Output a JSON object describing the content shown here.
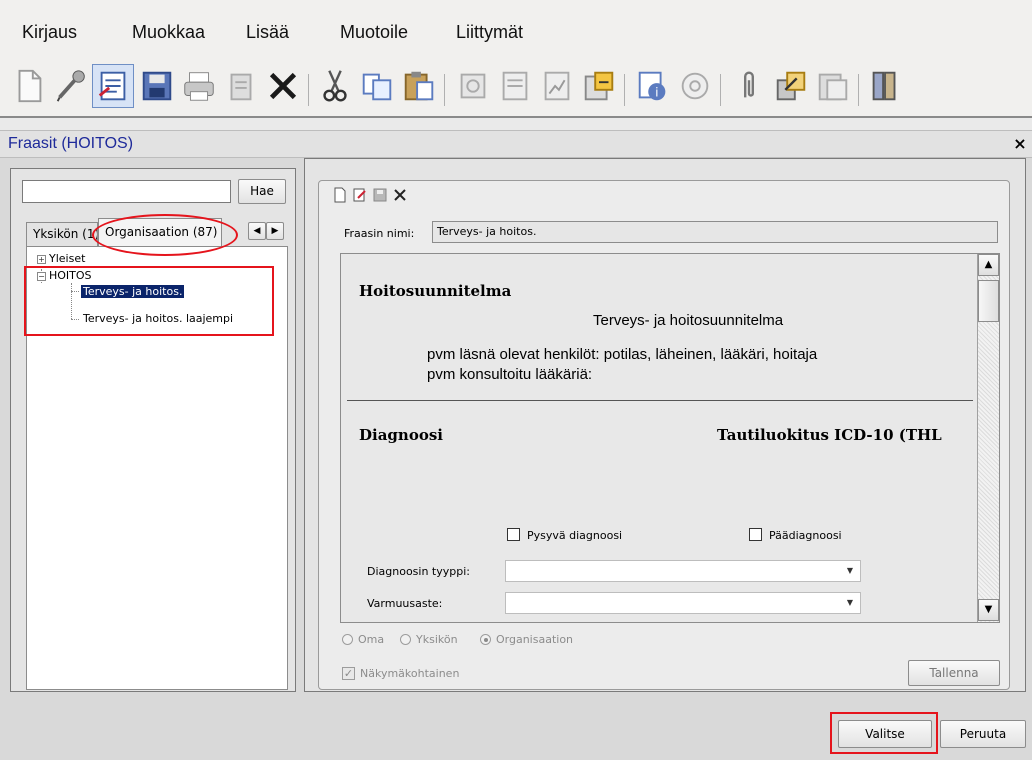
{
  "menu": {
    "items": [
      "Kirjaus",
      "Muokkaa",
      "Lisää",
      "Muotoile",
      "Liittymät"
    ]
  },
  "toolbar": {
    "icons": [
      "new-document-icon",
      "microphone-icon",
      "document-selected-icon",
      "save-icon",
      "print-icon",
      "archive-icon",
      "delete-icon",
      "cut-icon",
      "copy-icon",
      "paste-icon",
      "tool-icon",
      "form-icon",
      "chart-icon",
      "export-icon",
      "info-icon",
      "help-icon",
      "attachment-icon",
      "transfer-icon",
      "view-icon",
      "book-icon"
    ]
  },
  "dialog": {
    "title": "Fraasit (HOITOS)",
    "close_symbol": "×"
  },
  "left": {
    "search_placeholder": "",
    "search_button": "Hae",
    "tabs": [
      "Yksikön (1)",
      "Organisaation (87)"
    ],
    "tab_prev": "◀",
    "tab_next": "▶",
    "tree": {
      "yleiset": "Yleiset",
      "hoitos": "HOITOS",
      "children": [
        "Terveys- ja hoitos.",
        "Terveys- ja hoitos. laajempi"
      ],
      "expand_symbol": "+",
      "collapse_symbol": "−"
    }
  },
  "editor": {
    "name_label": "Fraasin nimi:",
    "name_value": "Terveys- ja hoitos.",
    "document": {
      "section1_heading": "Hoitosuunnitelma",
      "section1_center": "Terveys- ja hoitosuunnitelma",
      "line1": "pvm läsnä olevat henkilöt: potilas, läheinen, lääkäri, hoitaja",
      "line2": "pvm konsultoitu lääkäriä:",
      "section2_heading": "Diagnoosi",
      "section2_right": "Tautiluokitus ICD-10 (THL",
      "checkbox_permanent": "Pysyvä diagnoosi",
      "checkbox_main": "Päädiagnoosi",
      "diagnosis_type_label": "Diagnoosin tyyppi:",
      "certainty_label": "Varmuusaste:"
    },
    "radios": [
      "Oma",
      "Yksikön",
      "Organisaation"
    ],
    "radio_selected": "Organisaation",
    "view_specific": "Näkymäkohtainen",
    "save_button": "Tallenna"
  },
  "footer": {
    "select_button": "Valitse",
    "cancel_button": "Peruuta"
  },
  "colors": {
    "annotation": "#e5141c",
    "selection": "#0a246a",
    "title_text": "#1e2a9a"
  }
}
